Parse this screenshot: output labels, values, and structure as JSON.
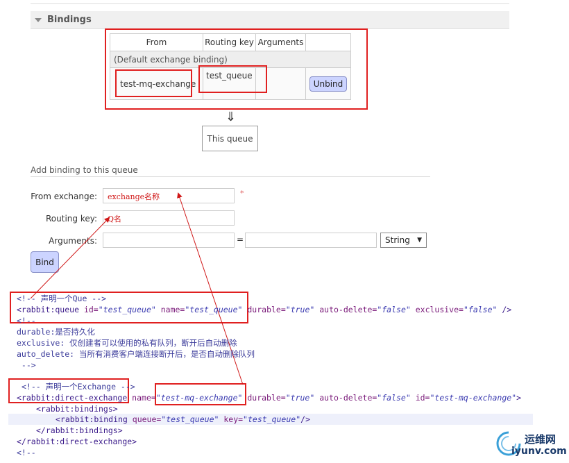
{
  "bindings_section": {
    "title": "Bindings"
  },
  "bindings_table": {
    "headers": [
      "From",
      "Routing key",
      "Arguments",
      ""
    ],
    "default_row": "(Default exchange binding)",
    "row": {
      "from": "test-mq-exchange",
      "routing_key": "test_queue",
      "arguments": "",
      "action": "Unbind"
    }
  },
  "flow": {
    "arrow": "⇓",
    "this_queue": "This queue"
  },
  "add_binding": {
    "title": "Add binding to this queue",
    "from_label": "From exchange:",
    "from_value": "exchange名称",
    "required_marker": "*",
    "routing_label": "Routing key:",
    "routing_value": "Q名",
    "arguments_label": "Arguments:",
    "equals": "=",
    "type_select": "String",
    "bind_button": "Bind"
  },
  "code": {
    "l1": "<!-- 声明一个Que -->",
    "l2_tag": "<rabbit:queue ",
    "l2_id_attr": "id=",
    "l2_id_val": "\"test_queue\"",
    "l2_name_attr": " name=",
    "l2_name_val": "\"test_queue\"",
    "l2_d_attr": " durable=",
    "l2_d_val": "\"true\"",
    "l2_ad_attr": " auto-delete=",
    "l2_ad_val": "\"false\"",
    "l2_ex_attr": " exclusive=",
    "l2_ex_val": "\"false\"",
    "l2_end": " />",
    "l3": "<!--",
    "l4": "durable:是否持久化",
    "l5": "exclusive: 仅创建者可以使用的私有队列，断开后自动删除",
    "l6": "auto_delete: 当所有消费客户端连接断开后，是否自动删除队列",
    "l7": " -->",
    "l8": "<!-- 声明一个Exchange -->",
    "l9_tag": "<rabbit:direct-exchange",
    "l9_name_attr": " name=",
    "l9_name_val": "\"test-mq-exchange\"",
    "l9_d_attr": " durable=",
    "l9_d_val": "\"true\"",
    "l9_ad_attr": " auto-delete=",
    "l9_ad_val": "\"false\"",
    "l9_id_attr": " id=",
    "l9_id_val": "\"test-mq-exchange\"",
    "l9_end": ">",
    "l10": "<rabbit:bindings>",
    "l11_tag": "<rabbit:binding",
    "l11_q_attr": " queue=",
    "l11_q_val": "\"test_queue\"",
    "l11_k_attr": " key=",
    "l11_k_val": "\"test_queue\"",
    "l11_end": "/>",
    "l12": "</rabbit:bindings>",
    "l13": "</rabbit:direct-exchange>",
    "l14": "<!--"
  },
  "watermark": {
    "name": "运维网",
    "url": "iyunv.com"
  },
  "colors": {
    "annotation_red": "#e02020",
    "button_blue": "#ccd4ff"
  }
}
